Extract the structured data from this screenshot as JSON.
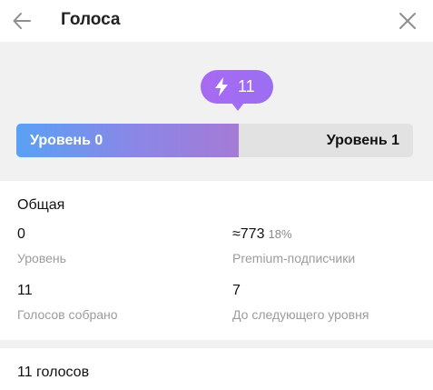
{
  "header": {
    "title": "Голоса",
    "back_icon": "arrow-left-icon",
    "close_icon": "close-icon"
  },
  "boost": {
    "count": "11",
    "icon": "lightning-icon",
    "colors": {
      "badge": "#a16df2",
      "progress_start": "#5aa1f4",
      "progress_end": "#a47bd5"
    }
  },
  "level": {
    "current_label": "Уровень 0",
    "next_label": "Уровень 1",
    "progress_fraction": 0.56
  },
  "stats": {
    "section_title": "Общая",
    "level_value": "0",
    "level_label": "Уровень",
    "premium_value": "≈773",
    "premium_pct": "18%",
    "premium_label": "Premium-подписчики",
    "collected_value": "11",
    "collected_label": "Голосов собрано",
    "next_value": "7",
    "next_label": "До следующего уровня"
  },
  "votes": {
    "title": "11 голосов"
  }
}
